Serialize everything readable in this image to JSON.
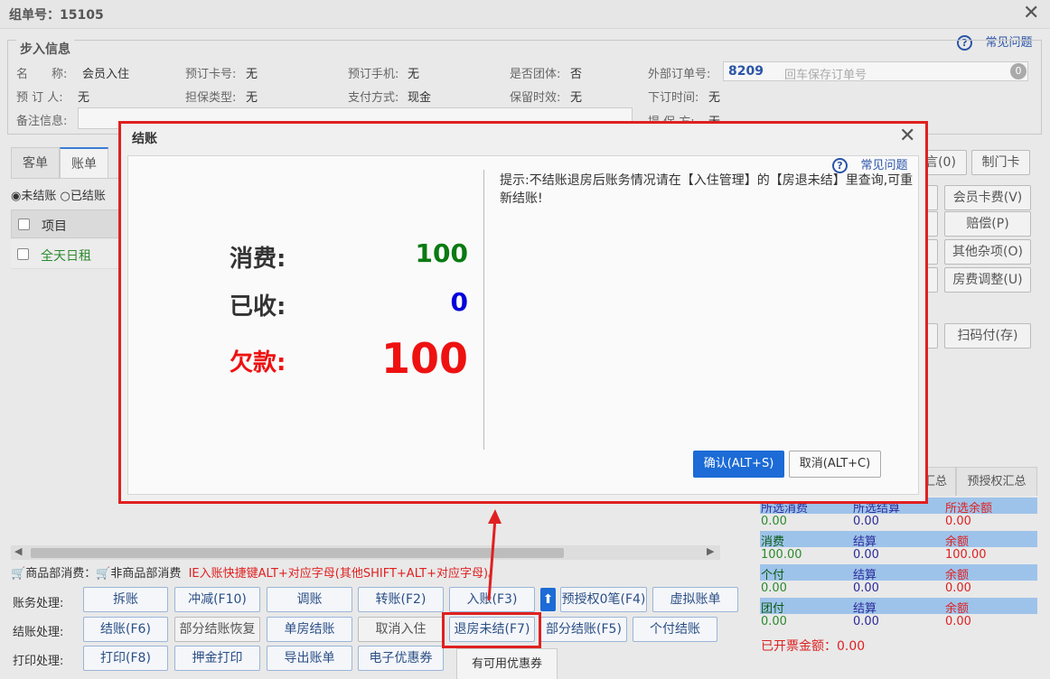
{
  "window": {
    "title": "组单号：15105"
  },
  "help": {
    "label": "常见问题"
  },
  "info": {
    "legend": "步入信息",
    "name_label": "名　　称:",
    "name_value": "会员入住",
    "reserve_card_label": "预订卡号:",
    "reserve_card_value": "无",
    "reserve_phone_label": "预订手机:",
    "reserve_phone_value": "无",
    "is_group_label": "是否团体:",
    "is_group_value": "否",
    "external_order_label": "外部订单号:",
    "external_order_value": "8209",
    "external_order_placeholder": "回车保存订单号",
    "external_order_badge": "0",
    "booker_label": "预 订 人:",
    "booker_value": "无",
    "guarantee_type_label": "担保类型:",
    "guarantee_type_value": "无",
    "pay_method_label": "支付方式:",
    "pay_method_value": "现金",
    "keep_label": "保留时效:",
    "keep_value": "无",
    "order_time_label": "下订时间:",
    "order_time_value": "无",
    "remark_label": "备注信息:",
    "cut_label": "提 保 方:",
    "cut_value": "无"
  },
  "tabs": [
    {
      "label": "客单"
    },
    {
      "label": "账单"
    }
  ],
  "bill_filter": {
    "unsettled": "未结账",
    "settled": "已结账"
  },
  "grid": {
    "header_item": "项目",
    "rows": [
      {
        "item": "全天日租"
      }
    ]
  },
  "right_buttons": {
    "msg": "言(0)",
    "door_card": "制门卡",
    "member_card": "会员卡费(V)",
    "compensation": "赔偿(P)",
    "other": "其他杂项(O)",
    "room_adjust": "房费调整(U)",
    "scan_pay": "扫码付(存)"
  },
  "summary": {
    "tabs": [
      "汇总",
      "预授权汇总"
    ],
    "rows": [
      {
        "type": "header",
        "c1": "所选消费",
        "c2": "所选结算",
        "c3": "所选余额"
      },
      {
        "type": "value",
        "c1": "0.00",
        "c2": "0.00",
        "c3": "0.00"
      },
      {
        "type": "header",
        "c1": "消费",
        "c2": "结算",
        "c3": "余额"
      },
      {
        "type": "value",
        "c1": "100.00",
        "c2": "0.00",
        "c3": "100.00"
      },
      {
        "type": "header",
        "c1": "个付",
        "c2": "结算",
        "c3": "余额"
      },
      {
        "type": "value",
        "c1": "0.00",
        "c2": "0.00",
        "c3": "0.00"
      },
      {
        "type": "header",
        "c1": "团付",
        "c2": "结算",
        "c3": "余额"
      },
      {
        "type": "value",
        "c1": "0.00",
        "c2": "0.00",
        "c3": "0.00"
      }
    ],
    "invoiced_label": "已开票金额：",
    "invoiced_value": "0.00"
  },
  "note": {
    "goods": "商品部消费",
    "non_goods": "非商品部消费",
    "shortcut": "IE入账快捷键ALT+对应字母(其他SHIFT+ALT+对应字母)。"
  },
  "actions": {
    "account_label": "账务处理:",
    "checkout_label": "结账处理:",
    "print_label": "打印处理:",
    "split": "拆账",
    "offset": "冲减(F10)",
    "adjust": "调账",
    "transfer": "转账(F2)",
    "post": "入账(F3)",
    "pre_auth": "预授权0笔(F4)",
    "virtual": "虚拟账单",
    "checkout": "结账(F6)",
    "partial_restore": "部分结账恢复",
    "single_room": "单房结账",
    "cancel_checkin": "取消入住",
    "checkout_unsettled": "退房未结(F7)",
    "partial_checkout": "部分结账(F5)",
    "personal_checkout": "个付结账",
    "print": "打印(F8)",
    "deposit_print": "押金打印",
    "export": "导出账单",
    "coupon": "电子优惠券"
  },
  "coupon_tip": "有可用优惠券",
  "modal": {
    "title": "结账",
    "consume_label": "消费:",
    "consume_value": "100",
    "received_label": "已收:",
    "received_value": "0",
    "owed_label": "欠款:",
    "owed_value": "100",
    "tip": "提示:不结账退房后账务情况请在【入住管理】的【房退未结】里查询,可重新结账!",
    "confirm": "确认(ALT+S)",
    "cancel": "取消(ALT+C)"
  },
  "colors": {
    "accent": "#1c6bd6",
    "consume": "#0a7a12",
    "received": "#0000dd",
    "owed": "#ee1111",
    "highlight": "#e02020"
  }
}
